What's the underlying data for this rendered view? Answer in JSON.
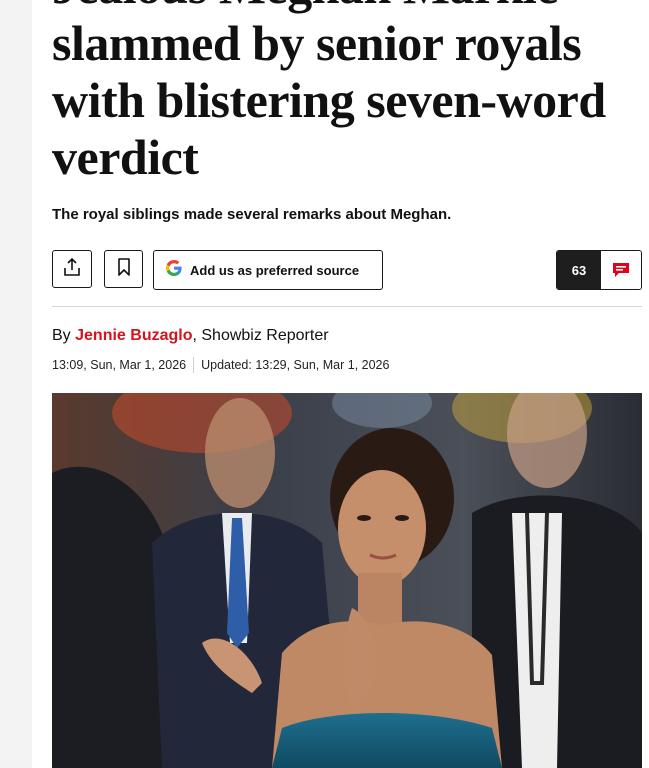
{
  "article": {
    "headline_lines": [
      "Jealous Meghan Markle",
      "slammed by senior royals",
      "with blistering seven-word",
      "verdict"
    ],
    "subheading": "The royal siblings made several remarks about Meghan.",
    "byline_prefix": "By ",
    "author": "Jennie Buzaglo",
    "author_role": ", Showbiz Reporter",
    "published": "13:09, Sun, Mar 1, 2026",
    "updated": "Updated: 13:29, Sun, Mar 1, 2026"
  },
  "actions": {
    "share_icon": "share-icon",
    "bookmark_icon": "bookmark-icon",
    "preferred_source_label": "Add us as preferred source",
    "google_icon": "google-g-icon",
    "comment_count": "63",
    "comment_icon": "comment-bubble-icon"
  },
  "colors": {
    "author_red": "#d7131f",
    "comment_bubble_red": "#e3001b",
    "count_bg": "#1e1e1e"
  }
}
